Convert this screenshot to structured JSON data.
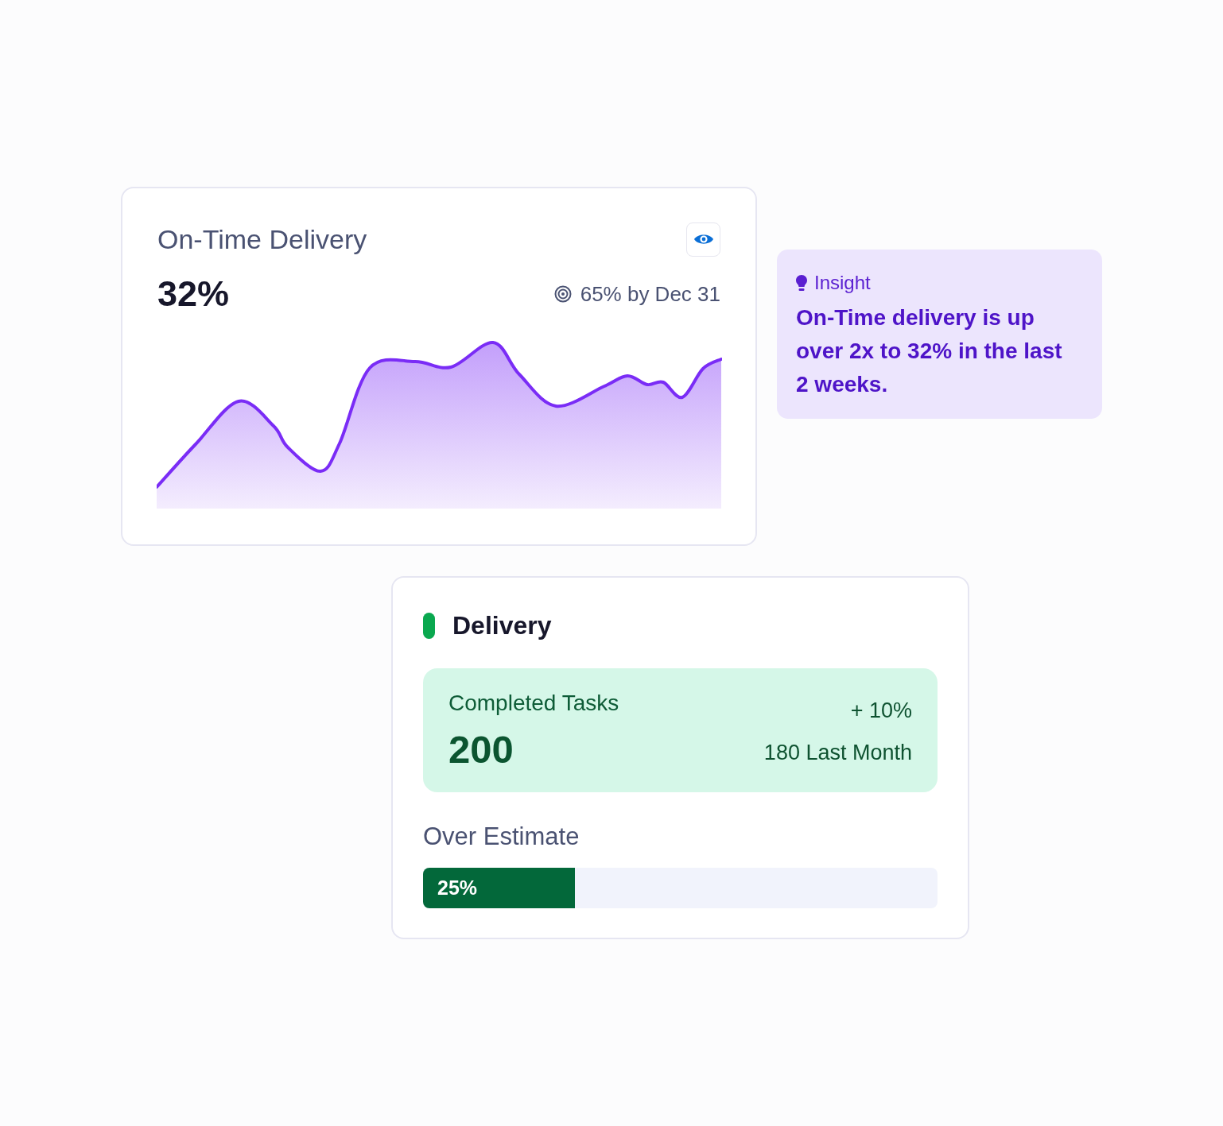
{
  "delivery_card": {
    "title": "On-Time Delivery",
    "value": "32%",
    "target": "65% by Dec 31"
  },
  "insight": {
    "label": "Insight",
    "text": "On-Time delivery is up over 2x to 32% in the last 2 weeks."
  },
  "summary_card": {
    "title": "Delivery",
    "stat": {
      "label": "Completed Tasks",
      "value": "200",
      "change": "+ 10%",
      "previous": "180 Last Month"
    },
    "progress": {
      "label": "Over Estimate",
      "level": 0.295,
      "reading": "25%"
    }
  }
}
